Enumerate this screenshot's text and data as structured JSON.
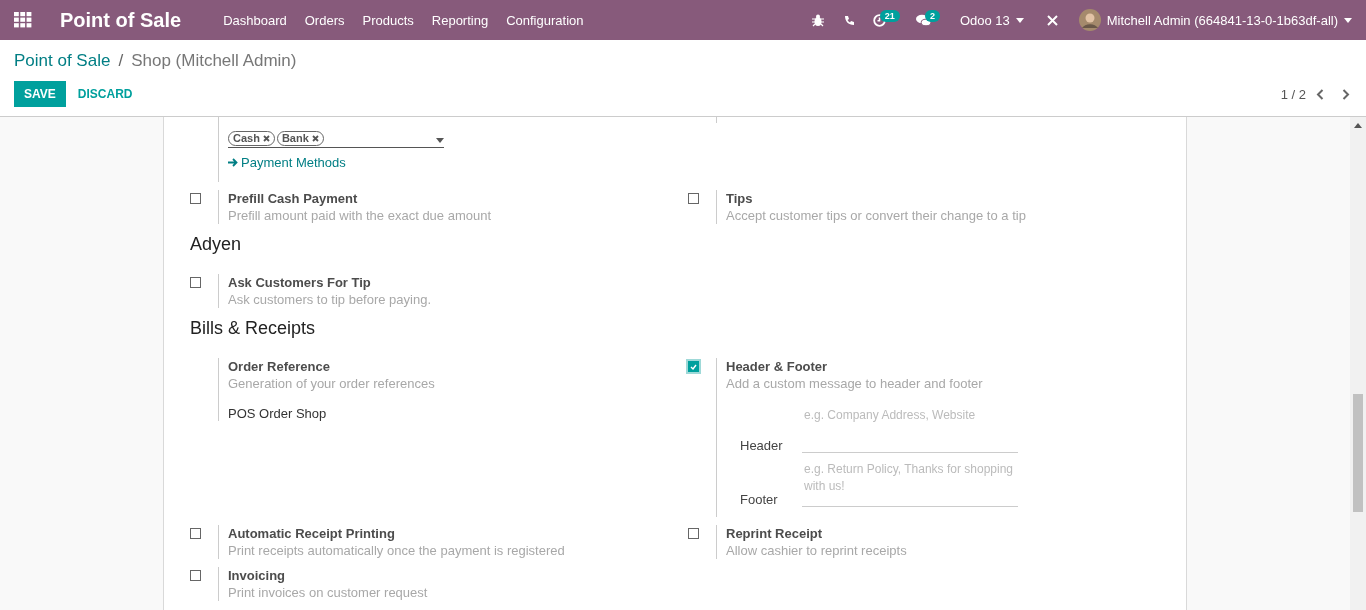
{
  "navbar": {
    "app_title": "Point of Sale",
    "menu": [
      "Dashboard",
      "Orders",
      "Products",
      "Reporting",
      "Configuration"
    ],
    "activity_count": "21",
    "message_count": "2",
    "database": "Odoo 13",
    "user": "Mitchell Admin (664841-13-0-1b63df-all)"
  },
  "breadcrumb": {
    "parent": "Point of Sale",
    "separator": "/",
    "current": "Shop (Mitchell Admin)"
  },
  "buttons": {
    "save": "SAVE",
    "discard": "DISCARD"
  },
  "pager": "1 / 2",
  "sections": [
    {
      "rows": [
        [
          {
            "kind": "tags",
            "tags": [
              "Cash",
              "Bank"
            ],
            "link": "Payment Methods"
          },
          {
            "kind": "blank"
          }
        ],
        [
          {
            "kind": "checkbox",
            "title": "Prefill Cash Payment",
            "description": "Prefill amount paid with the exact due amount",
            "checked": false
          },
          {
            "kind": "checkbox",
            "title": "Tips",
            "description": "Accept customer tips or convert their change to a tip",
            "checked": false
          }
        ]
      ]
    },
    {
      "title": "Adyen",
      "rows": [
        [
          {
            "kind": "checkbox",
            "title": "Ask Customers For Tip",
            "description": "Ask customers to tip before paying.",
            "checked": false
          }
        ]
      ]
    },
    {
      "title": "Bills & Receipts",
      "rows": [
        [
          {
            "kind": "text",
            "title": "Order Reference",
            "description": "Generation of your order references",
            "value": "POS Order Shop"
          },
          {
            "kind": "checkbox",
            "title": "Header & Footer",
            "description": "Add a custom message to header and footer",
            "checked": true,
            "fields": [
              {
                "label": "Header",
                "placeholder": "e.g. Company Address, Website"
              },
              {
                "label": "Footer",
                "placeholder": "e.g. Return Policy, Thanks for shopping with us!"
              }
            ]
          }
        ],
        [
          {
            "kind": "checkbox",
            "title": "Automatic Receipt Printing",
            "description": "Print receipts automatically once the payment is registered",
            "checked": false
          },
          {
            "kind": "checkbox",
            "title": "Reprint Receipt",
            "description": "Allow cashier to reprint receipts",
            "checked": false
          }
        ],
        [
          {
            "kind": "checkbox",
            "title": "Invoicing",
            "description": "Print invoices on customer request",
            "checked": false
          }
        ]
      ]
    }
  ]
}
